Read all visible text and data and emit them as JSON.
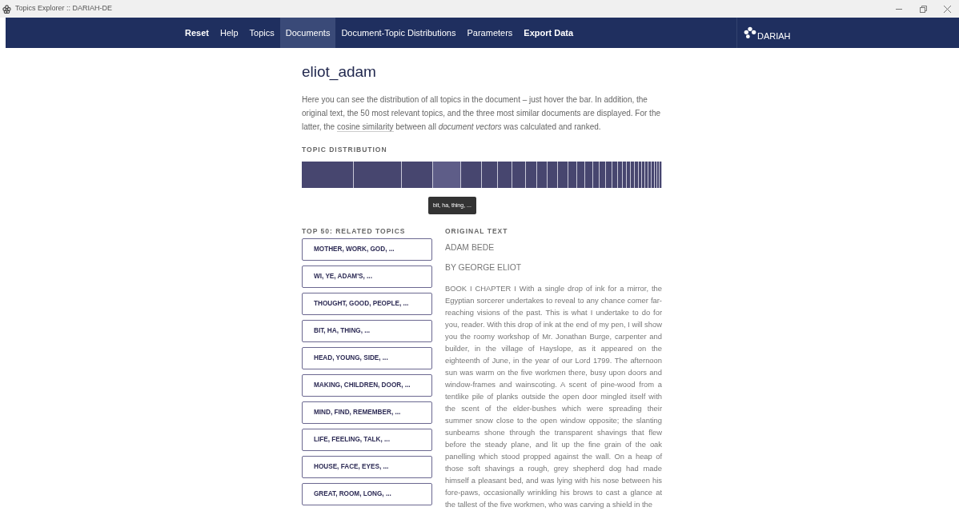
{
  "window": {
    "title": "Topics Explorer :: DARIAH-DE"
  },
  "nav": {
    "items": [
      {
        "label": "Reset",
        "bold": true,
        "selected": false
      },
      {
        "label": "Help",
        "bold": false,
        "selected": false
      },
      {
        "label": "Topics",
        "bold": false,
        "selected": false
      },
      {
        "label": "Documents",
        "bold": false,
        "selected": true
      },
      {
        "label": "Document-Topic Distributions",
        "bold": false,
        "selected": false
      },
      {
        "label": "Parameters",
        "bold": false,
        "selected": false
      },
      {
        "label": "Export Data",
        "bold": true,
        "selected": false
      }
    ],
    "logo": "DARIAH"
  },
  "document": {
    "title": "eliot_adam",
    "intro_parts": [
      "Here you can see the distribution of all topics in the document – just hover the bar. In addition, the original text, the 50 most relevant topics, and the three most similar documents are displayed. For the latter, the ",
      "cosine similarity",
      " between all *document vectors* was calculated and ranked."
    ],
    "distribution_heading": "TOPIC DISTRIBUTION",
    "segments": [
      {
        "selected": false
      },
      {
        "selected": false
      },
      {
        "selected": false
      },
      {
        "selected": true
      },
      {
        "selected": false
      },
      {
        "selected": false
      },
      {
        "selected": false
      },
      {
        "selected": false
      },
      {
        "selected": false
      },
      {
        "selected": false
      },
      {
        "selected": false
      },
      {
        "selected": false
      },
      {
        "selected": false
      },
      {
        "selected": false
      },
      {
        "selected": false
      },
      {
        "selected": false
      },
      {
        "selected": false
      },
      {
        "selected": false
      },
      {
        "selected": false
      },
      {
        "selected": false
      },
      {
        "selected": false
      },
      {
        "selected": false
      },
      {
        "selected": false
      },
      {
        "selected": false
      },
      {
        "selected": false
      },
      {
        "selected": false
      },
      {
        "selected": false
      },
      {
        "selected": false
      },
      {
        "selected": false
      },
      {
        "selected": false
      },
      {
        "selected": false
      },
      {
        "selected": false
      }
    ],
    "tooltip": "bit, ha, thing, ...",
    "topics_heading": "TOP 50: RELATED TOPICS",
    "topics": [
      "MOTHER, WORK, GOD, ...",
      "WI, YE, ADAM'S, ...",
      "THOUGHT, GOOD, PEOPLE, ...",
      "BIT, HA, THING, ...",
      "HEAD, YOUNG, SIDE, ...",
      "MAKING, CHILDREN, DOOR, ...",
      "MIND, FIND, REMEMBER, ...",
      "LIFE, FEELING, TALK, ...",
      "HOUSE, FACE, EYES, ...",
      "GREAT, ROOM, LONG, ..."
    ],
    "text_heading": "ORIGINAL TEXT",
    "text_title": "ADAM BEDE",
    "text_author": "BY GEORGE ELIOT",
    "text_body": "BOOK I CHAPTER I With a single drop of ink for a mirror, the Egyptian sorcerer undertakes to reveal to any chance comer far-reaching visions of the past. This is what I undertake to do for you, reader. With this drop of ink at the end of my pen, I will show you the roomy workshop of Mr. Jonathan Burge, carpenter and builder, in the village of Hayslope, as it appeared on the eighteenth of June, in the year of our Lord 1799. The afternoon sun was warm on the five workmen there, busy upon doors and window-frames and wainscoting. A scent of pine-wood from a tentlike pile of planks outside the open door mingled itself with the scent of the elder-bushes which were spreading their summer snow close to the open window opposite; the slanting sunbeams shone through the transparent shavings that flew before the steady plane, and lit up the fine grain of the oak panelling which stood propped against the wall. On a heap of those soft shavings a rough, grey shepherd dog had made himself a pleasant bed, and was lying with his nose between his fore-paws, occasionally wrinkling his brows to cast a glance at the tallest of the five workmen, who was carving a shield in the"
  }
}
